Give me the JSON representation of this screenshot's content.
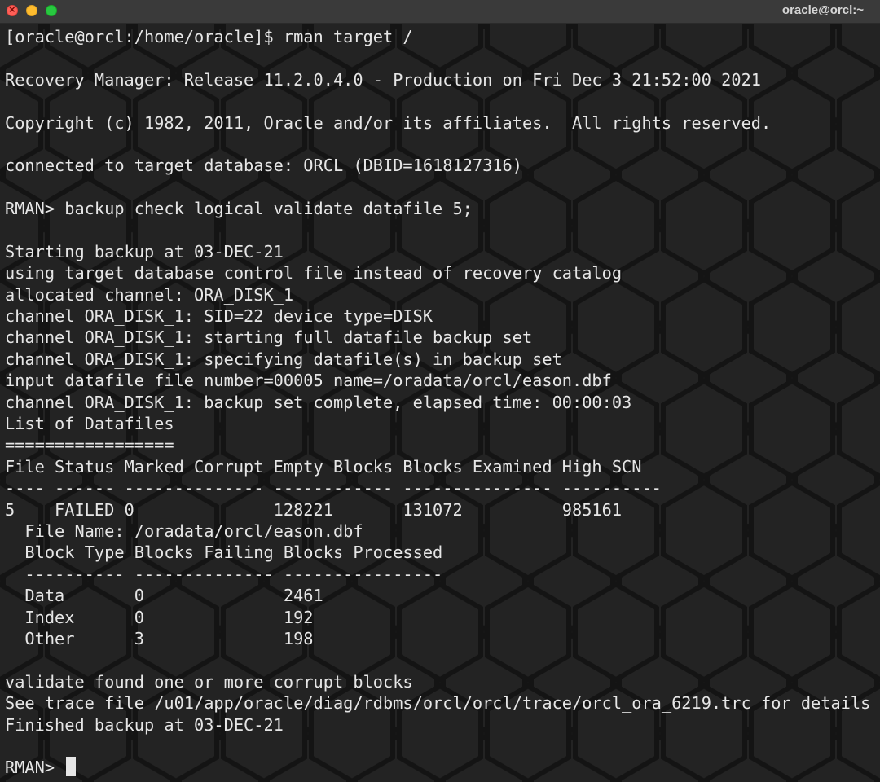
{
  "window": {
    "title": "oracle@orcl:~"
  },
  "terminal": {
    "lines": [
      "[oracle@orcl:/home/oracle]$ rman target /",
      "",
      "Recovery Manager: Release 11.2.0.4.0 - Production on Fri Dec 3 21:52:00 2021",
      "",
      "Copyright (c) 1982, 2011, Oracle and/or its affiliates.  All rights reserved.",
      "",
      "connected to target database: ORCL (DBID=1618127316)",
      "",
      "RMAN> backup check logical validate datafile 5;",
      "",
      "Starting backup at 03-DEC-21",
      "using target database control file instead of recovery catalog",
      "allocated channel: ORA_DISK_1",
      "channel ORA_DISK_1: SID=22 device type=DISK",
      "channel ORA_DISK_1: starting full datafile backup set",
      "channel ORA_DISK_1: specifying datafile(s) in backup set",
      "input datafile file number=00005 name=/oradata/orcl/eason.dbf",
      "channel ORA_DISK_1: backup set complete, elapsed time: 00:00:03",
      "List of Datafiles",
      "=================",
      "File Status Marked Corrupt Empty Blocks Blocks Examined High SCN",
      "---- ------ -------------- ------------ --------------- ----------",
      "5    FAILED 0              128221       131072          985161",
      "  File Name: /oradata/orcl/eason.dbf",
      "  Block Type Blocks Failing Blocks Processed",
      "  ---------- -------------- ----------------",
      "  Data       0              2461",
      "  Index      0              192",
      "  Other      3              198",
      "",
      "validate found one or more corrupt blocks",
      "See trace file /u01/app/oracle/diag/rdbms/orcl/orcl/trace/orcl_ora_6219.trc for details",
      "Finished backup at 03-DEC-21",
      "",
      "RMAN> "
    ]
  }
}
